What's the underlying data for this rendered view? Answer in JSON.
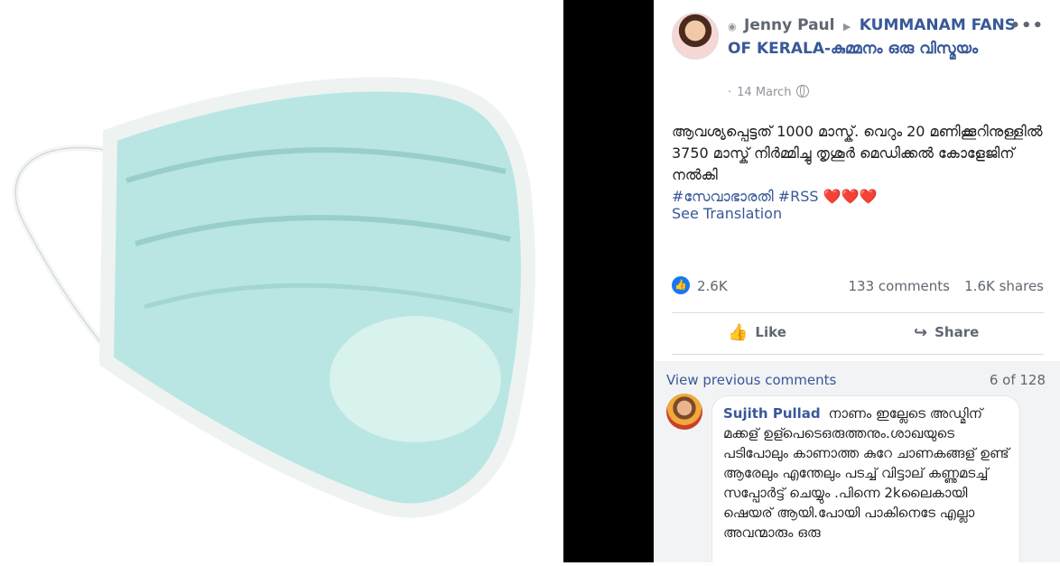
{
  "post": {
    "author_status_icon": "eye-icon",
    "author": "Jenny Paul",
    "arrow": "▶",
    "group": "KUMMANAM FANS OF KERALA-കുമ്മനം ഒരു വിസ്മയം",
    "more": "•••",
    "date": "14 March",
    "date_dot": "·",
    "text_main": "ആവശ്യപ്പെട്ടത് 1000 മാസ്ക്. വെറും 20 മണിക്കൂറിനുള്ളിൽ 3750 മാസ്ക് നിർമ്മിച്ചു തൃശൂർ മെഡിക്കൽ കോളേജിന് നൽകി",
    "hashtag1": "#സേവാഭാരതി",
    "hashtag2": "#RSS",
    "hearts": "❤️❤️❤️",
    "see_translation": "See Translation"
  },
  "stats": {
    "likes": "2.6K",
    "comments": "133 comments",
    "shares": "1.6K shares"
  },
  "actions": {
    "like": "Like",
    "share": "Share"
  },
  "comments": {
    "view_previous": "View previous comments",
    "pager": "6 of 128",
    "first": {
      "name": "Sujith Pullad",
      "text": "നാണം ഇല്ലേടെ അഡ്മിന് മക്കള് ഉള്പെടെഒരുത്തനും.ശാഖയുടെ പടിപോലും കാണാത്ത കുറേ ചാണകങ്ങള് ഉണ്ട് ആരേലും എന്തേലും പടച്ച് വിട്ടാല് കണ്ണുമടച്ച് സപ്പോർട്ട് ചെയ്യും .പിന്നെ 2kലൈകായി ഷെയര് ആയി.പോയി പാകിനെടേ എല്ലാ അവന്മാരും ഒരു"
    }
  },
  "colors": {
    "link": "#385898",
    "like_badge": "#1877f2",
    "heart": "#e41e3f"
  }
}
